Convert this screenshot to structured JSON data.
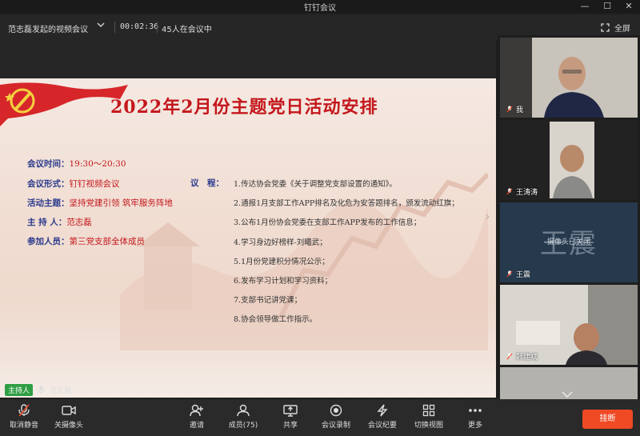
{
  "app": {
    "title": "钉钉会议"
  },
  "info": {
    "topic": "范志磊发起的视频会议",
    "timer": "00:02:36",
    "count": "45人在会议中",
    "fullscreen": "全屏"
  },
  "slide": {
    "title": "2022年2月份主题党日活动安排",
    "fields": [
      {
        "k": "会议时间：",
        "v": "19:30～20:30"
      },
      {
        "k": "会议形式：",
        "v": "钉钉视频会议"
      },
      {
        "k": "活动主题：",
        "v": "坚持党建引领 筑牢服务阵地"
      },
      {
        "k": "主 持 人：",
        "v": "范志磊"
      },
      {
        "k": "参加人员：",
        "v": "第三党支部全体成员"
      }
    ],
    "agenda_label": "议　程：",
    "agenda": [
      "1.传达协会党委《关于调整党支部设置的通知》。",
      "2.通报1月支部工作APP排名及化危为安答题排名，颁发流动红旗；",
      "3.公布1月份协会党委在支部工作APP发布的工作信息；",
      "4.学习身边好榜样-刘曦武；",
      "5.1月份党建积分情况公示；",
      "6.发布学习计划和学习资料；",
      "7.支部书记讲党课；",
      "8.协会领导做工作指示。"
    ]
  },
  "host": {
    "badge": "主持人",
    "name": "范志磊"
  },
  "participants": [
    {
      "name": "我"
    },
    {
      "name": "王涛涛"
    },
    {
      "name": "王震",
      "avatar_text": "王震",
      "camera_status": "摄像头已关闭"
    },
    {
      "name": "韩建斌"
    }
  ],
  "toolbar": {
    "mute": "取消静音",
    "camera": "关摄像头",
    "invite": "邀请",
    "members": "成员(75)",
    "share": "共享",
    "record": "会议录制",
    "minutes": "会议纪要",
    "view": "切换视图",
    "more": "更多",
    "hangup": "挂断"
  },
  "colors": {
    "accent_red": "#c4171c",
    "label_blue": "#2b3a8c",
    "hangup": "#f04a25",
    "host_green": "#2f9e44"
  }
}
